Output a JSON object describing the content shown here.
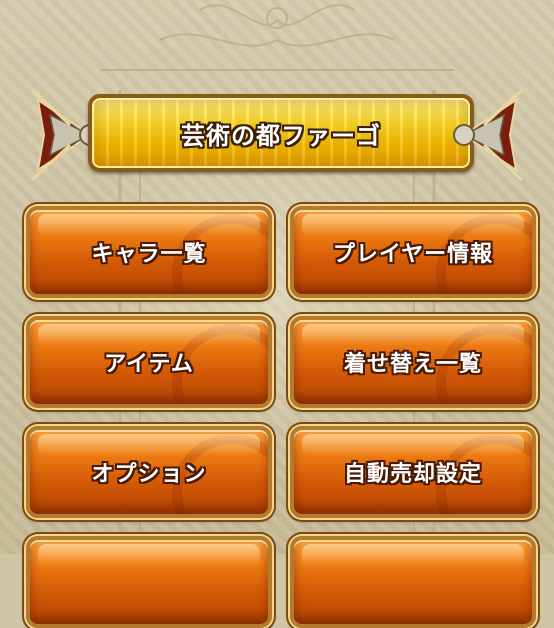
{
  "header": {
    "title": "芸術の都ファーゴ"
  },
  "menu": {
    "items": [
      {
        "label": "キャラ一覧"
      },
      {
        "label": "プレイヤー情報"
      },
      {
        "label": "アイテム"
      },
      {
        "label": "着せ替え一覧"
      },
      {
        "label": "オプション"
      },
      {
        "label": "自動売却設定"
      },
      {
        "label": ""
      },
      {
        "label": ""
      }
    ]
  },
  "colors": {
    "button_orange": "#ef7d14",
    "banner_gold": "#ffd92a",
    "background": "#cfc4a4",
    "text_outline": "#4a1a04"
  },
  "icons": {
    "banner_left": "ornament-fan-icon",
    "banner_right": "ornament-fan-icon"
  }
}
